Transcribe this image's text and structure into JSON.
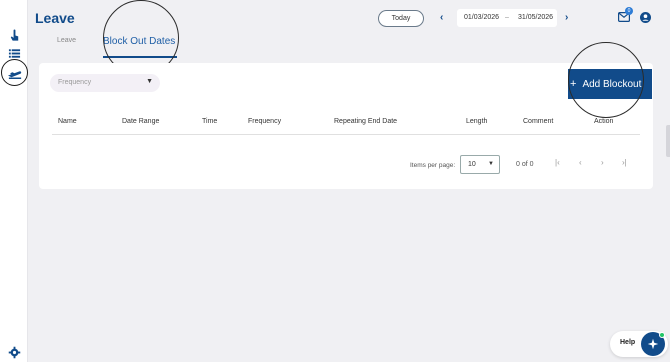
{
  "header": {
    "title": "Leave",
    "today_label": "Today",
    "date_start": "01/03/2026",
    "date_separator": "–",
    "date_end": "31/05/2026",
    "mail_badge_count": "0"
  },
  "tabs": [
    {
      "label": "Leave",
      "active": false
    },
    {
      "label": "Block Out Dates",
      "active": true
    }
  ],
  "filters": {
    "frequency_placeholder": "Frequency"
  },
  "actions": {
    "add_blockout_label": "Add Blockout"
  },
  "table": {
    "columns": [
      "Name",
      "Date Range",
      "Time",
      "Frequency",
      "Repeating End Date",
      "Length",
      "Comment",
      "Action"
    ],
    "rows": []
  },
  "pagination": {
    "items_per_page_label": "Items per page:",
    "items_per_page": "10",
    "range_text": "0 of 0"
  },
  "help": {
    "label": "Help"
  },
  "colors": {
    "primary": "#114b8a",
    "accent": "#1f5fa6",
    "badge": "#2f7dd6"
  }
}
